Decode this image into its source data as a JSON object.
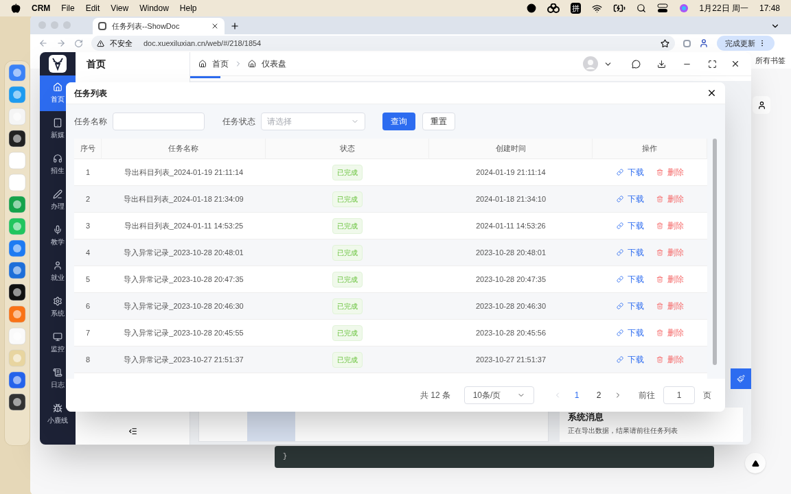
{
  "menubar": {
    "app": "CRM",
    "menus": [
      "File",
      "Edit",
      "View",
      "Window",
      "Help"
    ],
    "input_method": "拼",
    "date": "1月22日 周一",
    "time": "17:48"
  },
  "browser": {
    "tab_title": "任务列表--ShowDoc",
    "security": "不安全",
    "url": "doc.xuexiluxian.cn/web/#/218/1854",
    "update_button": "完成更新",
    "bookmarks": "所有书签",
    "code_tail": "}"
  },
  "app": {
    "sidebar": [
      {
        "kind": "home",
        "label": "首页",
        "selected": true
      },
      {
        "kind": "tablet",
        "label": "新媒",
        "selected": false
      },
      {
        "kind": "headset",
        "label": "招生",
        "selected": false
      },
      {
        "kind": "pen",
        "label": "办理",
        "selected": false
      },
      {
        "kind": "mic",
        "label": "教学",
        "selected": false
      },
      {
        "kind": "user",
        "label": "就业",
        "selected": false
      },
      {
        "kind": "gear",
        "label": "系统",
        "selected": false
      },
      {
        "kind": "monitor",
        "label": "监控",
        "selected": false
      },
      {
        "kind": "log",
        "label": "日志",
        "selected": false
      },
      {
        "kind": "bug",
        "label": "小鹿线",
        "selected": false
      }
    ],
    "panel_title": "首页",
    "breadcrumb": [
      "首页",
      "仪表盘"
    ],
    "system_messages": {
      "title": "系统消息",
      "item": "正在导出数据，结果请前往任务列表"
    }
  },
  "modal": {
    "title": "任务列表",
    "filters": {
      "name_label": "任务名称",
      "status_label": "任务状态",
      "status_placeholder": "请选择",
      "search_button": "查询",
      "reset_button": "重置"
    },
    "columns": [
      "序号",
      "任务名称",
      "状态",
      "创建时间",
      "操作"
    ],
    "rows": [
      {
        "index": "1",
        "name": "导出科目列表_2024-01-19 21:11:14",
        "status": "已完成",
        "created": "2024-01-19 21:11:14",
        "download": "下载",
        "delete": "删除"
      },
      {
        "index": "2",
        "name": "导出科目列表_2024-01-18 21:34:09",
        "status": "已完成",
        "created": "2024-01-18 21:34:10",
        "download": "下载",
        "delete": "删除"
      },
      {
        "index": "3",
        "name": "导出科目列表_2024-01-11 14:53:25",
        "status": "已完成",
        "created": "2024-01-11 14:53:26",
        "download": "下载",
        "delete": "删除"
      },
      {
        "index": "4",
        "name": "导入异常记录_2023-10-28 20:48:01",
        "status": "已完成",
        "created": "2023-10-28 20:48:01",
        "download": "下载",
        "delete": "删除"
      },
      {
        "index": "5",
        "name": "导入异常记录_2023-10-28 20:47:35",
        "status": "已完成",
        "created": "2023-10-28 20:47:35",
        "download": "下载",
        "delete": "删除"
      },
      {
        "index": "6",
        "name": "导入异常记录_2023-10-28 20:46:30",
        "status": "已完成",
        "created": "2023-10-28 20:46:30",
        "download": "下载",
        "delete": "删除"
      },
      {
        "index": "7",
        "name": "导入异常记录_2023-10-28 20:45:55",
        "status": "已完成",
        "created": "2023-10-28 20:45:56",
        "download": "下载",
        "delete": "删除"
      },
      {
        "index": "8",
        "name": "导入异常记录_2023-10-27 21:51:37",
        "status": "已完成",
        "created": "2023-10-27 21:51:37",
        "download": "下载",
        "delete": "删除"
      }
    ],
    "pagination": {
      "total": "共 12 条",
      "page_size": "10条/页",
      "pages": [
        {
          "label": "1",
          "selected": true
        },
        {
          "label": "2",
          "selected": false
        }
      ],
      "goto": "前往",
      "goto_value": "1",
      "page_suffix": "页"
    }
  }
}
